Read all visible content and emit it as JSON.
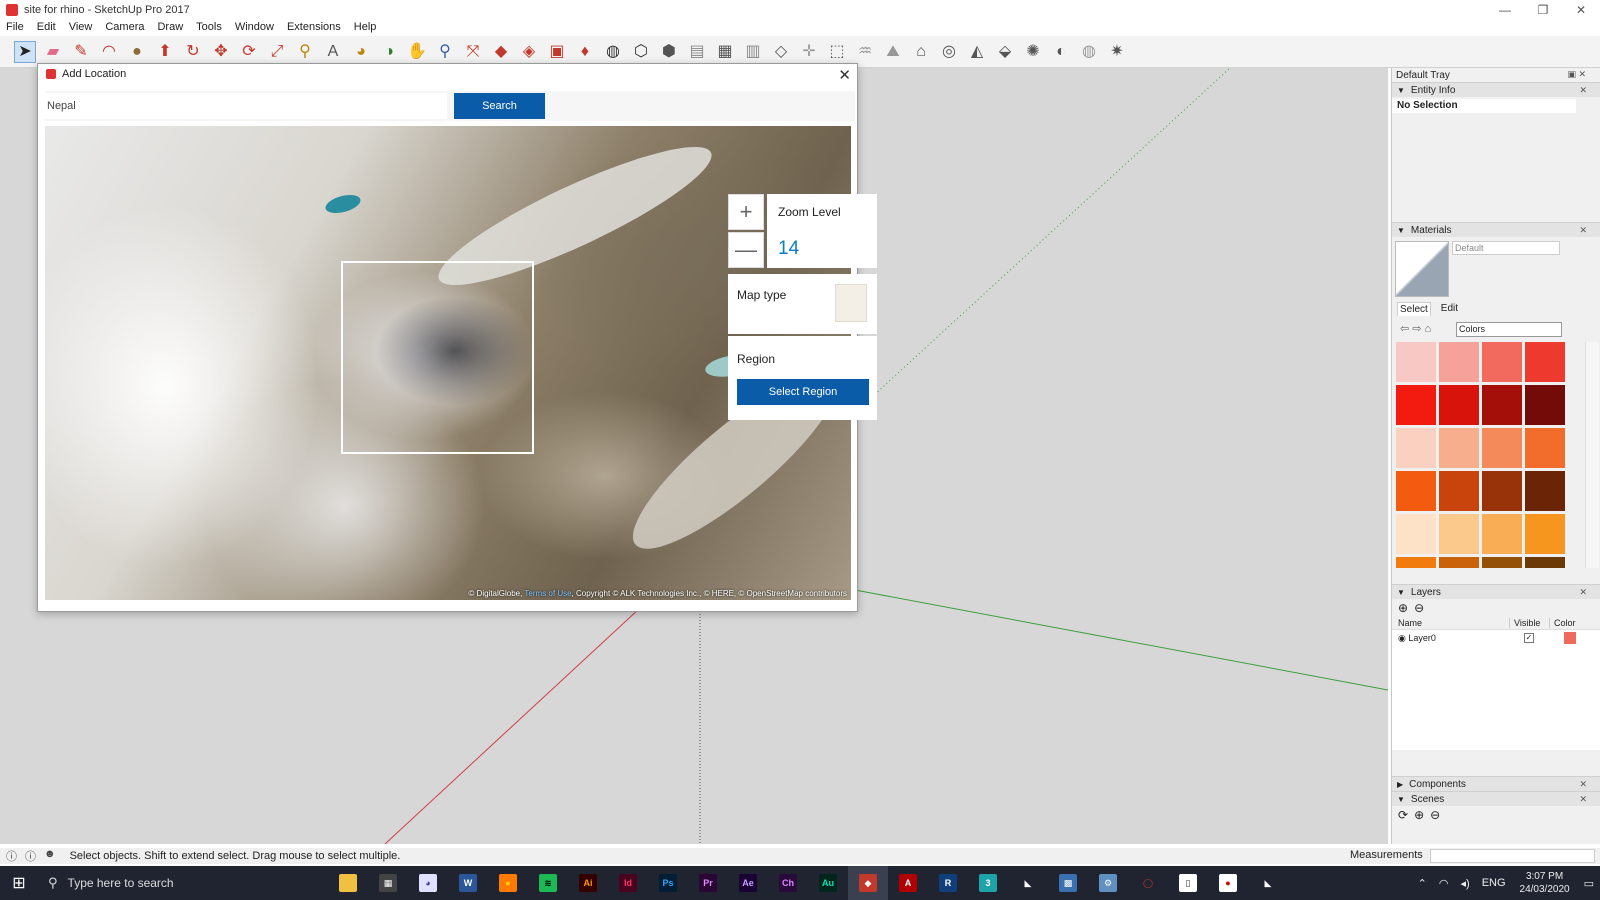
{
  "window": {
    "title": "site for rhino - SketchUp Pro 2017",
    "controls": [
      "—",
      "❐",
      "✕"
    ]
  },
  "menu": [
    "File",
    "Edit",
    "View",
    "Camera",
    "Draw",
    "Tools",
    "Window",
    "Extensions",
    "Help"
  ],
  "toolbar": {
    "tools": [
      {
        "icon": "select-arrow-icon",
        "glyph": "➤",
        "color": "#222222",
        "selected": true
      },
      {
        "icon": "eraser-icon",
        "glyph": "▰",
        "color": "#e06a8a"
      },
      {
        "icon": "pencil-icon",
        "glyph": "✎",
        "color": "#c0392b"
      },
      {
        "icon": "arc-icon",
        "glyph": "◠",
        "color": "#c0392b"
      },
      {
        "icon": "circle-icon",
        "glyph": "●",
        "color": "#8a6d3b"
      },
      {
        "icon": "push-pull-icon",
        "glyph": "⬆",
        "color": "#c0392b"
      },
      {
        "icon": "follow-me-icon",
        "glyph": "↻",
        "color": "#c0392b"
      },
      {
        "icon": "move-icon",
        "glyph": "✥",
        "color": "#c0392b"
      },
      {
        "icon": "rotate-icon",
        "glyph": "⟳",
        "color": "#c0392b"
      },
      {
        "icon": "scale-icon",
        "glyph": "⤢",
        "color": "#c0392b"
      },
      {
        "icon": "tape-measure-icon",
        "glyph": "⚲",
        "color": "#b8860b"
      },
      {
        "icon": "text-icon",
        "glyph": "A",
        "color": "#555555"
      },
      {
        "icon": "paint-bucket-icon",
        "glyph": "◕",
        "color": "#b8860b"
      },
      {
        "icon": "orbit-icon",
        "glyph": "◑",
        "color": "#2e7d32"
      },
      {
        "icon": "pan-icon",
        "glyph": "✋",
        "color": "#b8860b"
      },
      {
        "icon": "zoom-icon",
        "glyph": "⚲",
        "color": "#3a5fa0"
      },
      {
        "icon": "zoom-extents-icon",
        "glyph": "⤧",
        "color": "#c0392b"
      },
      {
        "icon": "warehouse-icon",
        "glyph": "◆",
        "color": "#c0392b"
      },
      {
        "icon": "extension-warehouse-icon",
        "glyph": "◈",
        "color": "#c0392b"
      },
      {
        "icon": "layout-icon",
        "glyph": "▣",
        "color": "#c0392b"
      },
      {
        "icon": "ruby-icon",
        "glyph": "♦",
        "color": "#c0392b"
      },
      {
        "icon": "xray-style-icon",
        "glyph": "◍",
        "color": "#333333"
      },
      {
        "icon": "wireframe-style-icon",
        "glyph": "⬡",
        "color": "#333333"
      },
      {
        "icon": "hidden-line-style-icon",
        "glyph": "⬢",
        "color": "#555555"
      },
      {
        "icon": "shaded-style-icon",
        "glyph": "▤",
        "color": "#888888"
      },
      {
        "icon": "textured-style-icon",
        "glyph": "▦",
        "color": "#555555"
      },
      {
        "icon": "monochrome-style-icon",
        "glyph": "▥",
        "color": "#888888"
      },
      {
        "icon": "section-plane-icon",
        "glyph": "◇",
        "color": "#555555"
      },
      {
        "icon": "axes-icon",
        "glyph": "✛",
        "color": "#999999"
      },
      {
        "icon": "iso-view-icon",
        "glyph": "⬚",
        "color": "#555555"
      },
      {
        "icon": "sandbox-icon",
        "glyph": "♒",
        "color": "#999999"
      },
      {
        "icon": "drape-icon",
        "glyph": "⛰",
        "color": "#999999"
      },
      {
        "icon": "add-location-icon",
        "glyph": "⌂",
        "color": "#555555"
      },
      {
        "icon": "geo-icon",
        "glyph": "◎",
        "color": "#555555"
      },
      {
        "icon": "photo-texture-icon",
        "glyph": "◭",
        "color": "#555555"
      },
      {
        "icon": "match-photo-icon",
        "glyph": "⬙",
        "color": "#555555"
      },
      {
        "icon": "shadows-icon",
        "glyph": "✺",
        "color": "#555555"
      },
      {
        "icon": "fog-icon",
        "glyph": "◐",
        "color": "#555555"
      },
      {
        "icon": "globe-icon",
        "glyph": "◍",
        "color": "#999999"
      },
      {
        "icon": "settings-icon",
        "glyph": "✷",
        "color": "#555555"
      }
    ]
  },
  "dialog": {
    "title": "Add Location",
    "close": "✕",
    "search_value": "Nepal",
    "search_button": "Search",
    "zoom_label": "Zoom Level",
    "zoom_value": "14",
    "zoom_in": "+",
    "zoom_out": "—",
    "map_type_label": "Map type",
    "region_label": "Region",
    "select_region_button": "Select Region",
    "attribution_prefix": "© DigitalGlobe,",
    "attribution_link": "Terms of Use",
    "attribution_suffix": ", Copyright © ALK Technologies Inc., © HERE, © OpenStreetMap contributors"
  },
  "tray": {
    "title": "Default Tray",
    "entity_info": {
      "header": "Entity Info",
      "value": "No Selection"
    },
    "materials": {
      "header": "Materials",
      "name_value": "Default",
      "tabs": [
        "Select",
        "Edit"
      ],
      "library": "Colors",
      "swatches": [
        "#f8c8c4",
        "#f6a19a",
        "#f26a5e",
        "#ee3a2e",
        "#f31a10",
        "#d7130c",
        "#a50f0a",
        "#730c08",
        "#fad0c0",
        "#f7ae8d",
        "#f48a5a",
        "#f26d2c",
        "#f35b10",
        "#c9430c",
        "#983209",
        "#6b2406",
        "#fde2c7",
        "#fcc98d",
        "#f9ad55",
        "#f7961e",
        "#f17c0d",
        "#c9620a",
        "#955007",
        "#6a3905"
      ]
    },
    "layers": {
      "header": "Layers",
      "col_name": "Name",
      "col_visible": "Visible",
      "col_color": "Color",
      "rows": [
        {
          "name": "Layer0",
          "visible": "✓",
          "color": "#ee6a5a"
        }
      ]
    },
    "components": {
      "header": "Components"
    },
    "scenes": {
      "header": "Scenes"
    }
  },
  "status": {
    "text": "Select objects. Shift to extend select. Drag mouse to select multiple.",
    "measurements": "Measurements"
  },
  "taskbar": {
    "search_placeholder": "Type here to search",
    "apps": [
      {
        "icon": "file-explorer-icon",
        "label": "",
        "bg": "#f0c040",
        "fg": "#000000"
      },
      {
        "icon": "calculator-icon",
        "label": "▦",
        "bg": "#444444",
        "fg": "#ffffff"
      },
      {
        "icon": "paint3d-icon",
        "label": "◕",
        "bg": "#e0e0ff",
        "fg": "#3a3aa0"
      },
      {
        "icon": "word-icon",
        "label": "W",
        "bg": "#2b579a",
        "fg": "#ffffff"
      },
      {
        "icon": "firefox-icon",
        "label": "●",
        "bg": "#ff7a00",
        "fg": "#ffd000"
      },
      {
        "icon": "spotify-icon",
        "label": "≋",
        "bg": "#1db954",
        "fg": "#000000"
      },
      {
        "icon": "illustrator-icon",
        "label": "Ai",
        "bg": "#330000",
        "fg": "#ff9a00"
      },
      {
        "icon": "indesign-icon",
        "label": "Id",
        "bg": "#49021f",
        "fg": "#ff3366"
      },
      {
        "icon": "photoshop-icon",
        "label": "Ps",
        "bg": "#001e36",
        "fg": "#31a8ff"
      },
      {
        "icon": "premiere-icon",
        "label": "Pr",
        "bg": "#2a0634",
        "fg": "#e08cff"
      },
      {
        "icon": "after-effects-icon",
        "label": "Ae",
        "bg": "#1a0033",
        "fg": "#c79fff"
      },
      {
        "icon": "character-animator-icon",
        "label": "Ch",
        "bg": "#2a0a3a",
        "fg": "#d98cff"
      },
      {
        "icon": "audition-icon",
        "label": "Au",
        "bg": "#00261c",
        "fg": "#00e4bb"
      },
      {
        "icon": "sketchup-icon",
        "label": "◆",
        "bg": "#c0392b",
        "fg": "#ffffff",
        "active": true
      },
      {
        "icon": "autocad-icon",
        "label": "A",
        "bg": "#b00000",
        "fg": "#ffffff"
      },
      {
        "icon": "revit-icon",
        "label": "R",
        "bg": "#0f3e7a",
        "fg": "#ffffff"
      },
      {
        "icon": "3dsmax-icon",
        "label": "3",
        "bg": "#1ea3a8",
        "fg": "#ffffff"
      },
      {
        "icon": "rhino-icon",
        "label": "◣",
        "bg": "#1f2430",
        "fg": "#ffffff"
      },
      {
        "icon": "app-icon-19",
        "label": "▩",
        "bg": "#3a70b0",
        "fg": "#ffffff"
      },
      {
        "icon": "app-icon-20",
        "label": "⚙",
        "bg": "#6090c0",
        "fg": "#ffffff"
      },
      {
        "icon": "app-icon-21",
        "label": "◯",
        "bg": "#1f2430",
        "fg": "#c0392b"
      },
      {
        "icon": "notepad-icon",
        "label": "▯",
        "bg": "#ffffff",
        "fg": "#333333"
      },
      {
        "icon": "record-icon",
        "label": "●",
        "bg": "#ffffff",
        "fg": "#e00000"
      },
      {
        "icon": "rhino6-icon",
        "label": "◣",
        "bg": "#1f2430",
        "fg": "#ffffff"
      }
    ],
    "language": "ENG",
    "time": "3:07 PM",
    "date": "24/03/2020"
  }
}
